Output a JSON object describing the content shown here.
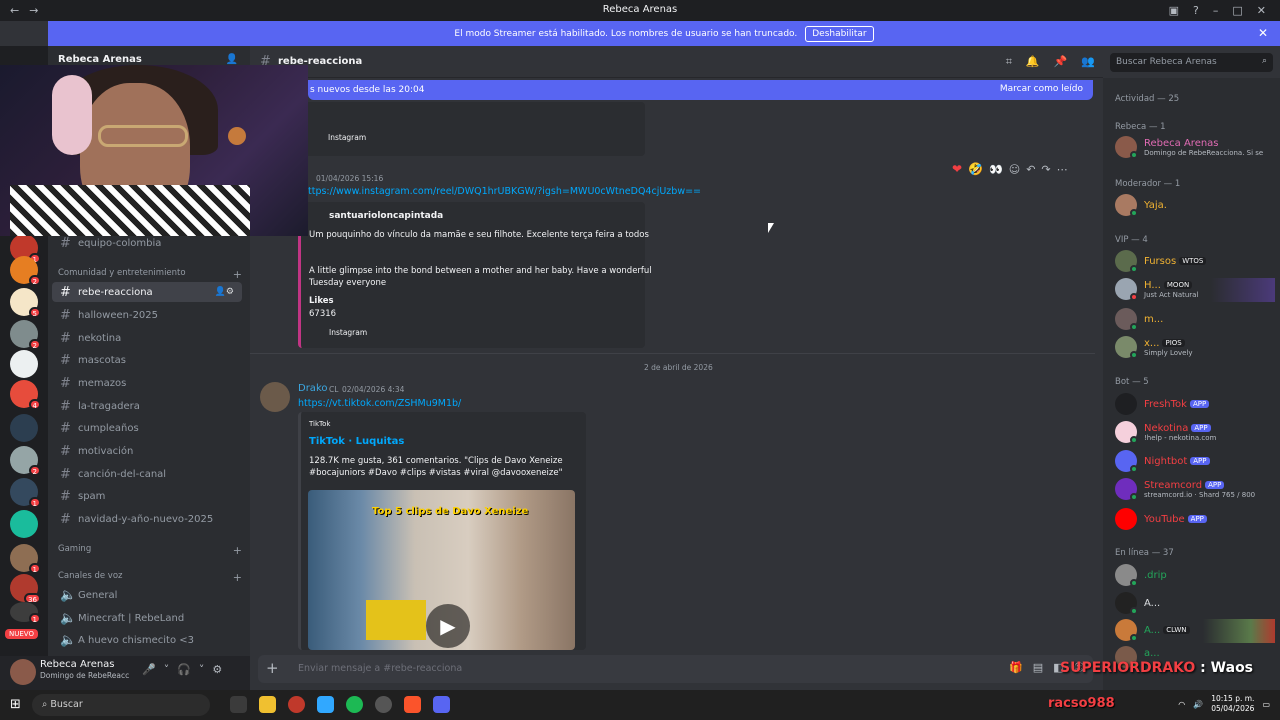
{
  "window": {
    "title": "Rebeca Arenas"
  },
  "banner": {
    "text": "El modo Streamer está habilitado. Los nombres de usuario se han truncado.",
    "button": "Deshabilitar"
  },
  "guilds": {
    "new_label": "NUEVO",
    "badges": [
      "1",
      "2",
      "5",
      "2",
      "4",
      "2",
      "1",
      "1",
      "36",
      "1"
    ]
  },
  "server": {
    "name": "Rebeca Arenas"
  },
  "channels": {
    "top": [
      "equipo-colombia"
    ],
    "cat_comunidad": "Comunidad y entretenimiento",
    "list": [
      "rebe-reacciona",
      "halloween-2025",
      "nekotina",
      "mascotas",
      "memazos",
      "la-tragadera",
      "cumpleaños",
      "motivación",
      "canción-del-canal",
      "spam",
      "navidad-y-año-nuevo-2025"
    ],
    "cat_gaming": "Gaming",
    "cat_voz": "Canales de voz",
    "voice": [
      "General",
      "Minecraft | RebeLand",
      "A huevo chismecito <3"
    ]
  },
  "user_panel": {
    "name": "Rebeca Arenas",
    "status": "Domingo de RebeReacc"
  },
  "chat": {
    "channel": "rebe-reacciona",
    "new_messages": "s nuevos desde las 20:04",
    "mark_read": "Marcar como leído",
    "embed1_footer": "Instagram",
    "msg2_time": "01/04/2026 15:16",
    "msg2_link": "ttps://www.instagram.com/reel/DWQ1hrUBKGW/?igsh=MWU0cWtneDQ4cjUzbw==",
    "embed2_author": "santuarioloncapintada",
    "embed2_line1": "Um pouquinho do vínculo da mamãe e seu filhote. Excelente terça feira a todos",
    "embed2_line2": "A little glimpse into the bond between a mother and her baby. Have a wonderful",
    "embed2_line3": "Tuesday everyone",
    "embed2_likes_label": "Likes",
    "embed2_likes": "67316",
    "embed2_footer": "Instagram",
    "date_divider": "2 de abril de 2026",
    "msg3_author": "Drako",
    "msg3_tag": "CL",
    "msg3_time": "02/04/2026 4:34",
    "msg3_link": "https://vt.tiktok.com/ZSHMu9M1b/",
    "embed3_provider": "TikTok",
    "embed3_title": "TikTok · Luquitas",
    "embed3_desc1": "128.7K me gusta, 361 comentarios. \"Clips de Davo Xeneize",
    "embed3_desc2": "#bocajuniors #Davo #clips #vistas #viral @davooxeneize\"",
    "video_caption": "Top 5 clips de Davo Xeneize",
    "composer_placeholder": "Enviar mensaje a #rebe-reacciona"
  },
  "search": {
    "placeholder": "Buscar Rebeca Arenas"
  },
  "members": {
    "activity": "Actividad — 25",
    "sec_rebeca": "Rebeca — 1",
    "rebeca": {
      "name": "Rebeca Arenas",
      "status": "Domingo de RebeReacciona. Si se"
    },
    "sec_mod": "Moderador — 1",
    "mod": {
      "name": "Yaja."
    },
    "sec_vip": "VIP — 4",
    "vip": [
      {
        "name": "Fursos",
        "chip": "WTOS",
        "status": ""
      },
      {
        "name": "H...",
        "chip": "MOON",
        "status": "Just Act Natural"
      },
      {
        "name": "m...",
        "chip": "",
        "status": ""
      },
      {
        "name": "x...",
        "chip": "PIOS",
        "status": "Simply Lovely"
      }
    ],
    "sec_bot": "Bot — 5",
    "bots": [
      {
        "name": "FreshTok",
        "tag": "APP",
        "status": ""
      },
      {
        "name": "Nekotina",
        "tag": "APP",
        "status": "!help - nekotina.com"
      },
      {
        "name": "Nightbot",
        "tag": "APP",
        "status": ""
      },
      {
        "name": "Streamcord",
        "tag": "APP",
        "status": "streamcord.io · Shard 765 / 800"
      },
      {
        "name": "YouTube",
        "tag": "APP",
        "status": ""
      }
    ],
    "sec_online": "En línea — 37",
    "online": [
      {
        "name": ".drip",
        "chip": ""
      },
      {
        "name": "A...",
        "chip": ""
      },
      {
        "name": "A...",
        "chip": "CLWN"
      },
      {
        "name": "a...",
        "chip": ""
      }
    ]
  },
  "overlay": {
    "user": "SUPERIORDRAKO",
    "sep": " : ",
    "msg": "Waos",
    "racso": "racso988"
  },
  "taskbar": {
    "search": "Buscar",
    "time": "10:15 p. m.",
    "date": "05/04/2026"
  }
}
